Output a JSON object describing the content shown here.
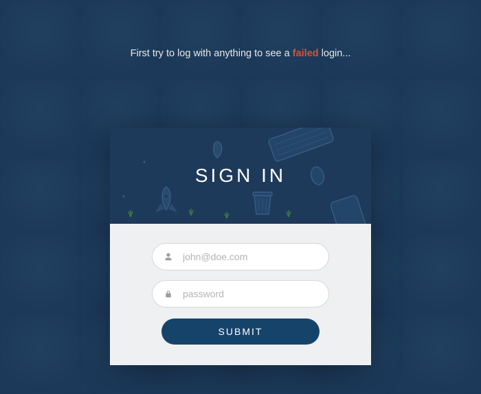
{
  "instruction": {
    "prefix": "First try to log with anything to see a ",
    "highlight": "failed",
    "suffix": " login..."
  },
  "card": {
    "title": "SIGN IN",
    "email": {
      "placeholder": "john@doe.com",
      "value": "",
      "icon": "user-icon"
    },
    "password": {
      "placeholder": "password",
      "value": "",
      "icon": "lock-icon"
    },
    "submit_label": "SUBMIT"
  },
  "colors": {
    "bg": "#1a3a5c",
    "card_header": "#1e3a5a",
    "accent_error": "#e64a3b",
    "button": "#16436a"
  }
}
